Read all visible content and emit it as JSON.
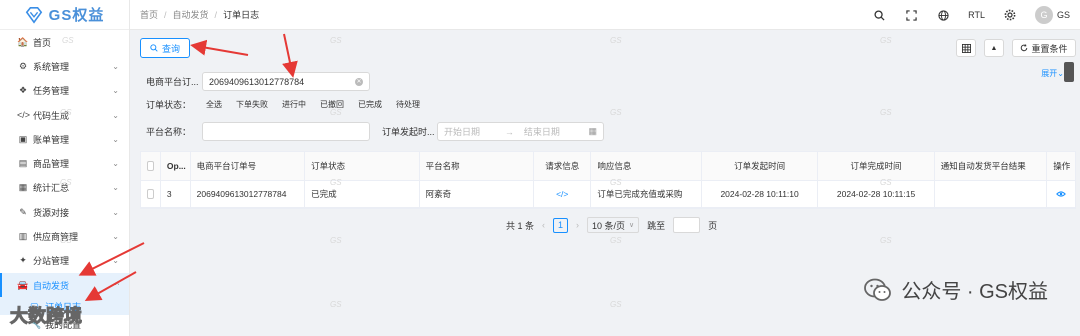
{
  "brand": {
    "logo_text": "GS权益"
  },
  "sidebar": {
    "items": [
      {
        "label": "首页",
        "icon": "home-icon",
        "glyph": "🏠",
        "chevron": false
      },
      {
        "label": "系统管理",
        "icon": "gears-icon",
        "glyph": "⚙",
        "chevron": true
      },
      {
        "label": "任务管理",
        "icon": "cubes-icon",
        "glyph": "❖",
        "chevron": true
      },
      {
        "label": "代码生成",
        "icon": "code-icon",
        "glyph": "</>",
        "chevron": true
      },
      {
        "label": "账单管理",
        "icon": "bill-icon",
        "glyph": "▣",
        "chevron": true
      },
      {
        "label": "商品管理",
        "icon": "goods-icon",
        "glyph": "▤",
        "chevron": true
      },
      {
        "label": "统计汇总",
        "icon": "table-icon",
        "glyph": "▦",
        "chevron": true
      },
      {
        "label": "货源对接",
        "icon": "plug-icon",
        "glyph": "✎",
        "chevron": true
      },
      {
        "label": "供应商管理",
        "icon": "supplier-icon",
        "glyph": "▥",
        "chevron": true
      },
      {
        "label": "分站管理",
        "icon": "branch-icon",
        "glyph": "✦",
        "chevron": true
      },
      {
        "label": "自动发货",
        "icon": "car-icon",
        "glyph": "🚘",
        "chevron": true,
        "active": true
      }
    ],
    "submenu": [
      {
        "label": "订单日志",
        "icon": "order-log-icon",
        "glyph": "▢",
        "active": true
      },
      {
        "label": "我的配置",
        "icon": "wrench-icon",
        "glyph": "🔧",
        "active": false
      }
    ]
  },
  "header": {
    "breadcrumb": [
      "首页",
      "自动发货",
      "订单日志"
    ],
    "rtl_label": "RTL",
    "avatar_letter": "G",
    "username": "GS"
  },
  "toolbar": {
    "query_label": "查询",
    "reset_label": "重置条件"
  },
  "filters": {
    "order_no_label": "电商平台订...",
    "order_no_value": "2069409613012778784",
    "status_label": "订单状态：",
    "status_options": [
      "全选",
      "下单失败",
      "进行中",
      "已撤回",
      "已完成",
      "待处理"
    ],
    "platform_label": "平台名称：",
    "platform_value": "",
    "time_label": "订单发起时...",
    "start_placeholder": "开始日期",
    "end_placeholder": "结束日期",
    "expand_label": "展开"
  },
  "table": {
    "headers": [
      "Op...",
      "电商平台订单号",
      "订单状态",
      "平台名称",
      "请求信息",
      "响应信息",
      "订单发起时间",
      "订单完成时间",
      "通知自动发货平台结果",
      "操作"
    ],
    "rows": [
      {
        "op": "3",
        "order_no": "2069409613012778784",
        "status": "已完成",
        "platform": "阿紊奇",
        "request": "</>",
        "response": "订单已完成充值或采购",
        "start_time": "2024-02-28 10:11:10",
        "end_time": "2024-02-28 10:11:15",
        "notify": ""
      }
    ]
  },
  "pagination": {
    "total_label": "共 1 条",
    "current_page": "1",
    "page_size": "10 条/页",
    "jump_label": "跳至",
    "page_label": "页"
  },
  "overlays": {
    "watermark_text": "GS",
    "wechat_label": "公众号 · GS权益",
    "bottom_watermark": "大数跨境"
  },
  "colors": {
    "accent": "#1890ff",
    "arrow": "#e53935"
  }
}
